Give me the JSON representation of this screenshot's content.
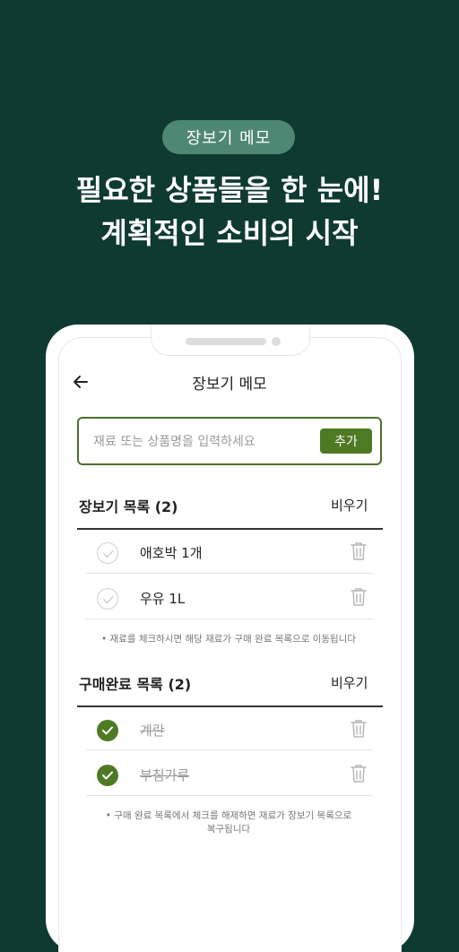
{
  "promo": {
    "badge": "장보기 메모",
    "headline_line1": "필요한 상품들을 한 눈에!",
    "headline_line2": "계획적인 소비의 시작"
  },
  "screen": {
    "title": "장보기 메모",
    "input": {
      "placeholder": "재료 또는 상품명을 입력하세요",
      "add_label": "추가"
    },
    "shopping": {
      "title": "장보기 목록 (2)",
      "clear_label": "비우기",
      "items": [
        {
          "label": "애호박 1개",
          "checked": false
        },
        {
          "label": "우유 1L",
          "checked": false
        }
      ],
      "hint": "• 재료를 체크하시면 해당 재료가 구매 완료 목록으로 이동됩니다"
    },
    "purchased": {
      "title": "구매완료 목록 (2)",
      "clear_label": "비우기",
      "items": [
        {
          "label": "계란",
          "checked": true
        },
        {
          "label": "부침가루",
          "checked": true
        }
      ],
      "hint_line1": "• 구매 완료 목록에서 체크를 해제하면 재료가 장보기 목록으로",
      "hint_line2": "복구됩니다"
    }
  },
  "colors": {
    "background": "#0f3a31",
    "badge": "#4f8775",
    "accent": "#4f7a24"
  },
  "icons": {
    "back": "arrow-left-icon",
    "check": "check-icon",
    "trash": "trash-icon"
  }
}
